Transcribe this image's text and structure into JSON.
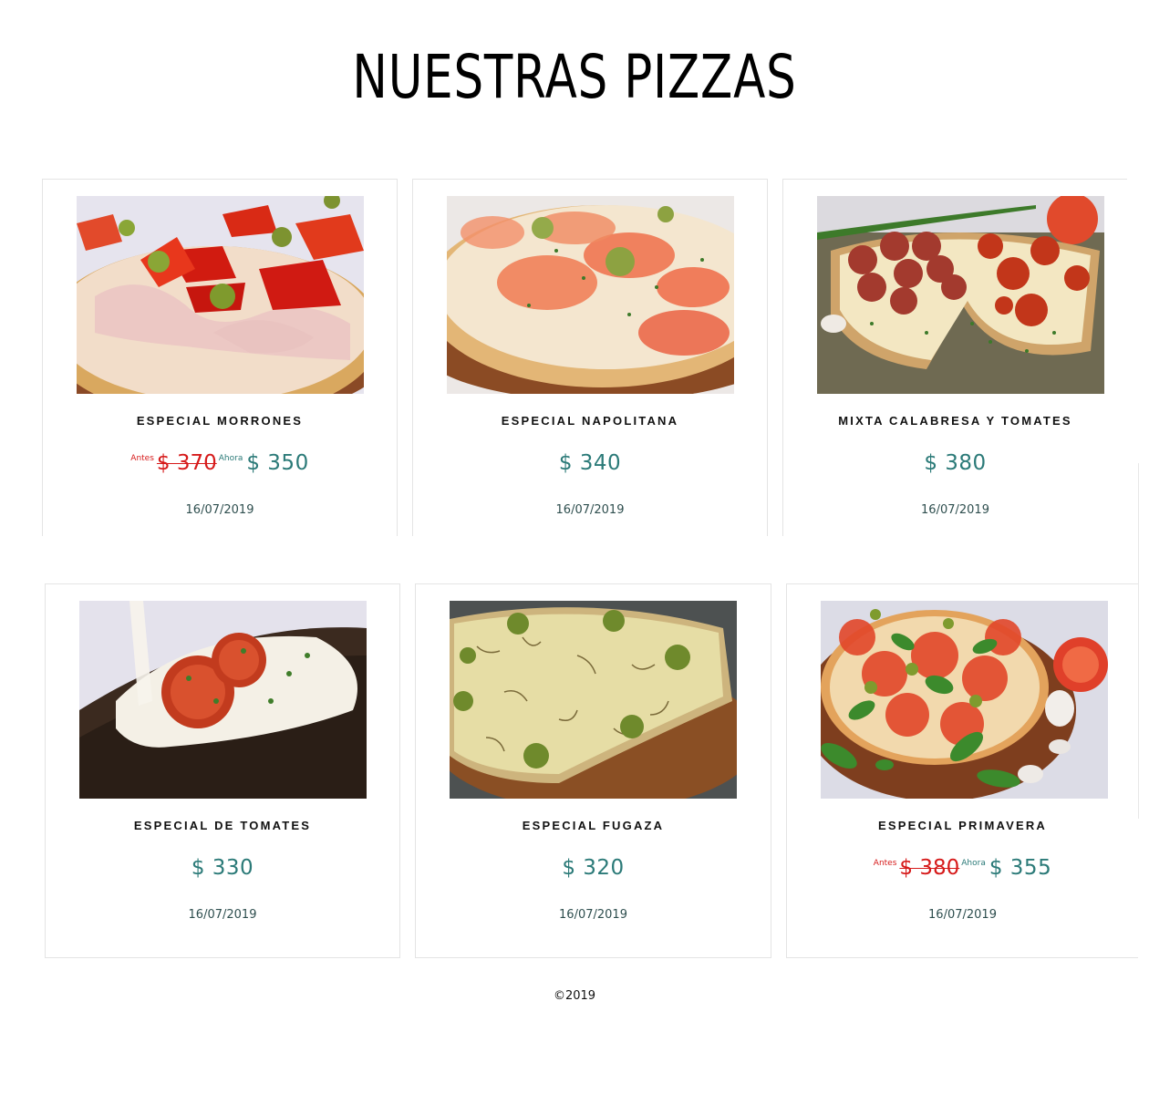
{
  "page": {
    "title": "NUESTRAS PIZZAS",
    "footer": "©2019"
  },
  "pizzas": [
    {
      "name": "ESPECIAL MORRONES",
      "antes_label": "Antes",
      "old_price": "$ 370",
      "ahora_label": "Ahora",
      "price": "$ 350",
      "date": "16/07/2019",
      "photo_icon": "pizza-morrones-photo"
    },
    {
      "name": "ESPECIAL NAPOLITANA",
      "price": "$ 340",
      "date": "16/07/2019",
      "photo_icon": "pizza-napolitana-photo"
    },
    {
      "name": "MIXTA CALABRESA Y TOMATES",
      "price": "$ 380",
      "date": "16/07/2019",
      "photo_icon": "pizza-calabresa-photo"
    },
    {
      "name": "ESPECIAL DE TOMATES",
      "price": "$ 330",
      "date": "16/07/2019",
      "photo_icon": "pizza-tomates-photo"
    },
    {
      "name": "ESPECIAL FUGAZA",
      "price": "$ 320",
      "date": "16/07/2019",
      "photo_icon": "pizza-fugaza-photo"
    },
    {
      "name": "ESPECIAL PRIMAVERA",
      "antes_label": "Antes",
      "old_price": "$ 380",
      "ahora_label": "Ahora",
      "price": "$ 355",
      "date": "16/07/2019",
      "photo_icon": "pizza-primavera-photo"
    }
  ],
  "colors": {
    "price": "#2b7a78",
    "old_price": "#d61a1a",
    "card_border": "#e4e4e4"
  }
}
